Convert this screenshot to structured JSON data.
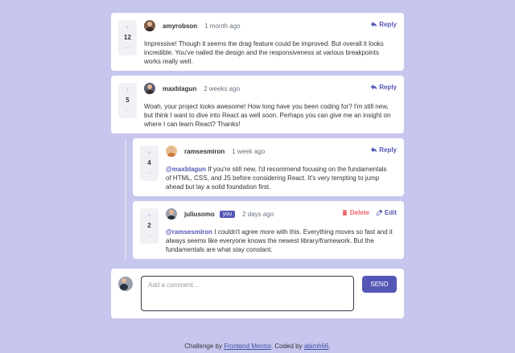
{
  "comments": [
    {
      "score": "12",
      "username": "amyrobson",
      "time": "1 month ago",
      "action": "Reply",
      "line1": "Impressive! Though it seems the drag feature could be improved. But overall it looks",
      "line2": "incredible. You've nailed the design and the responsiveness at various breakpoints",
      "line3": "works really well."
    },
    {
      "score": "5",
      "username": "maxblagun",
      "time": "2 weeks ago",
      "action": "Reply",
      "line1": "Woah, your project looks awesome! How long have you been coding for? I'm still new,",
      "line2": "but think I want to dive into React as well soon. Perhaps you can give me an insight on",
      "line3": "where I can learn React? Thanks!"
    }
  ],
  "replies": [
    {
      "score": "4",
      "username": "ramsesmiron",
      "time": "1 week ago",
      "action": "Reply",
      "mention": "@maxblagun",
      "line1": " If you're still new, I'd recommend focusing on the fundamentals",
      "line2": "of HTML, CSS, and JS before considering React. It's very tempting to jump",
      "line3": "ahead but lay a solid foundation first."
    },
    {
      "score": "2",
      "username": "juliusomo",
      "badge": "you",
      "time": "2 days ago",
      "delete_label": "Delete",
      "edit_label": "Edit",
      "mention": "@ramsesmiron",
      "line1": " I couldn't agree more with this. Everything moves so fast and it",
      "line2": "always seems like everyone knows the newest library/framework. But the",
      "line3": "fundamentals are what stay constant."
    }
  ],
  "vote_plus": "+",
  "vote_minus": "−",
  "composer": {
    "placeholder": "Add a comment...",
    "send_label": "SEND"
  },
  "footer": {
    "prefix": "Challenge by ",
    "link1": "Frontend Mentor",
    "middle": ". Coded by ",
    "link2": "abimh66",
    "suffix": "."
  },
  "colors": {
    "background": "#c6c6ee",
    "accent": "#5457b6",
    "danger": "#ed6368"
  },
  "icons": {
    "reply": "reply-arrow-icon",
    "delete": "trash-icon",
    "edit": "pencil-icon"
  }
}
